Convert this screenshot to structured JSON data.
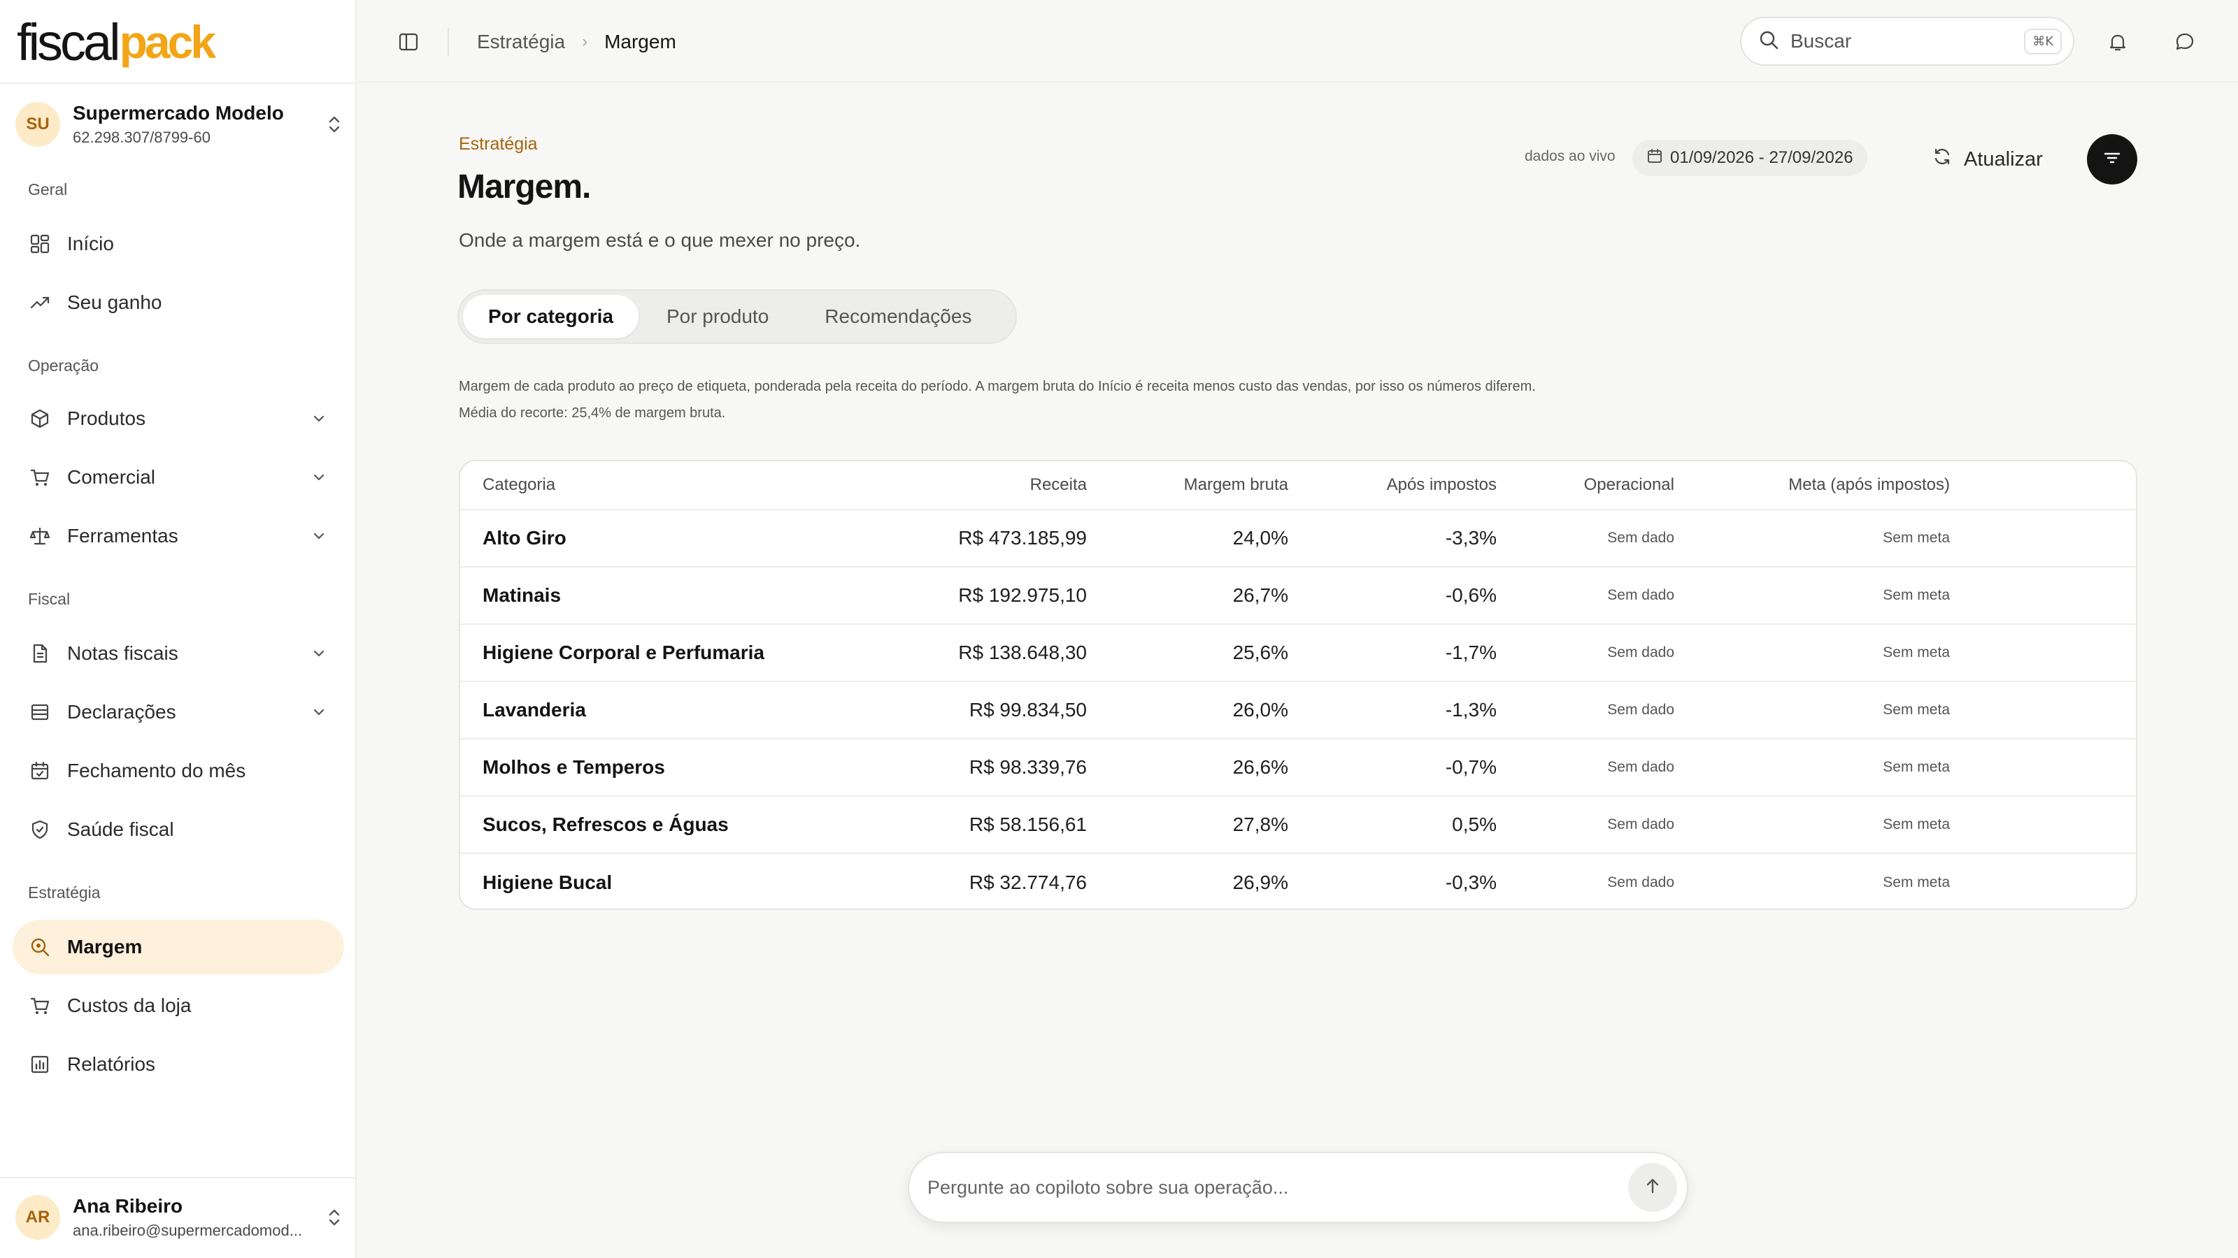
{
  "app": {
    "logo_part1": "fiscal",
    "logo_part2": "pack"
  },
  "org": {
    "initials": "SU",
    "name": "Supermercado Modelo",
    "cnpj": "62.298.307/8799-60"
  },
  "sidebar": {
    "sections": {
      "geral": "Geral",
      "operacao": "Operação",
      "fiscal": "Fiscal",
      "estrategia": "Estratégia"
    },
    "items": [
      {
        "label": "Início"
      },
      {
        "label": "Seu ganho"
      },
      {
        "label": "Produtos"
      },
      {
        "label": "Comercial"
      },
      {
        "label": "Ferramentas"
      },
      {
        "label": "Notas fiscais"
      },
      {
        "label": "Declarações"
      },
      {
        "label": "Fechamento do mês"
      },
      {
        "label": "Saúde fiscal"
      },
      {
        "label": "Margem"
      },
      {
        "label": "Custos da loja"
      },
      {
        "label": "Relatórios"
      }
    ]
  },
  "user": {
    "initials": "AR",
    "name": "Ana Ribeiro",
    "email": "ana.ribeiro@supermercadomod..."
  },
  "topbar": {
    "breadcrumb": [
      "Estratégia",
      "Margem"
    ],
    "search_placeholder": "Buscar",
    "search_shortcut": "⌘K"
  },
  "page": {
    "eyebrow": "Estratégia",
    "title": "Margem.",
    "subtitle": "Onde a margem está e o que mexer no preço.",
    "live_label": "dados ao vivo",
    "date_range": "01/09/2026 - 27/09/2026",
    "refresh_label": "Atualizar",
    "tabs": [
      "Por categoria",
      "Por produto",
      "Recomendações"
    ],
    "note_line1": "Margem de cada produto ao preço de etiqueta, ponderada pela receita do período. A margem bruta do Início é receita menos custo das vendas, por isso os números diferem.",
    "note_line2": "Média do recorte: 25,4% de margem bruta."
  },
  "table": {
    "headers": [
      "Categoria",
      "Receita",
      "Margem bruta",
      "Após impostos",
      "Operacional",
      "Meta (após impostos)"
    ],
    "rows": [
      [
        "Alto Giro",
        "R$ 473.185,99",
        "24,0%",
        "-3,3%",
        "Sem dado",
        "Sem meta"
      ],
      [
        "Matinais",
        "R$ 192.975,10",
        "26,7%",
        "-0,6%",
        "Sem dado",
        "Sem meta"
      ],
      [
        "Higiene Corporal e Perfumaria",
        "R$ 138.648,30",
        "25,6%",
        "-1,7%",
        "Sem dado",
        "Sem meta"
      ],
      [
        "Lavanderia",
        "R$ 99.834,50",
        "26,0%",
        "-1,3%",
        "Sem dado",
        "Sem meta"
      ],
      [
        "Molhos e Temperos",
        "R$ 98.339,76",
        "26,6%",
        "-0,7%",
        "Sem dado",
        "Sem meta"
      ],
      [
        "Sucos, Refrescos e Águas",
        "R$ 58.156,61",
        "27,8%",
        "0,5%",
        "Sem dado",
        "Sem meta"
      ],
      [
        "Higiene Bucal",
        "R$ 32.774,76",
        "26,9%",
        "-0,3%",
        "Sem dado",
        "Sem meta"
      ]
    ]
  },
  "copilot": {
    "placeholder": "Pergunte ao copiloto sobre sua operação..."
  },
  "colors": {
    "accent": "#f2a516",
    "accent_dark": "#a8620b",
    "active_bg": "#fdf1dc"
  }
}
